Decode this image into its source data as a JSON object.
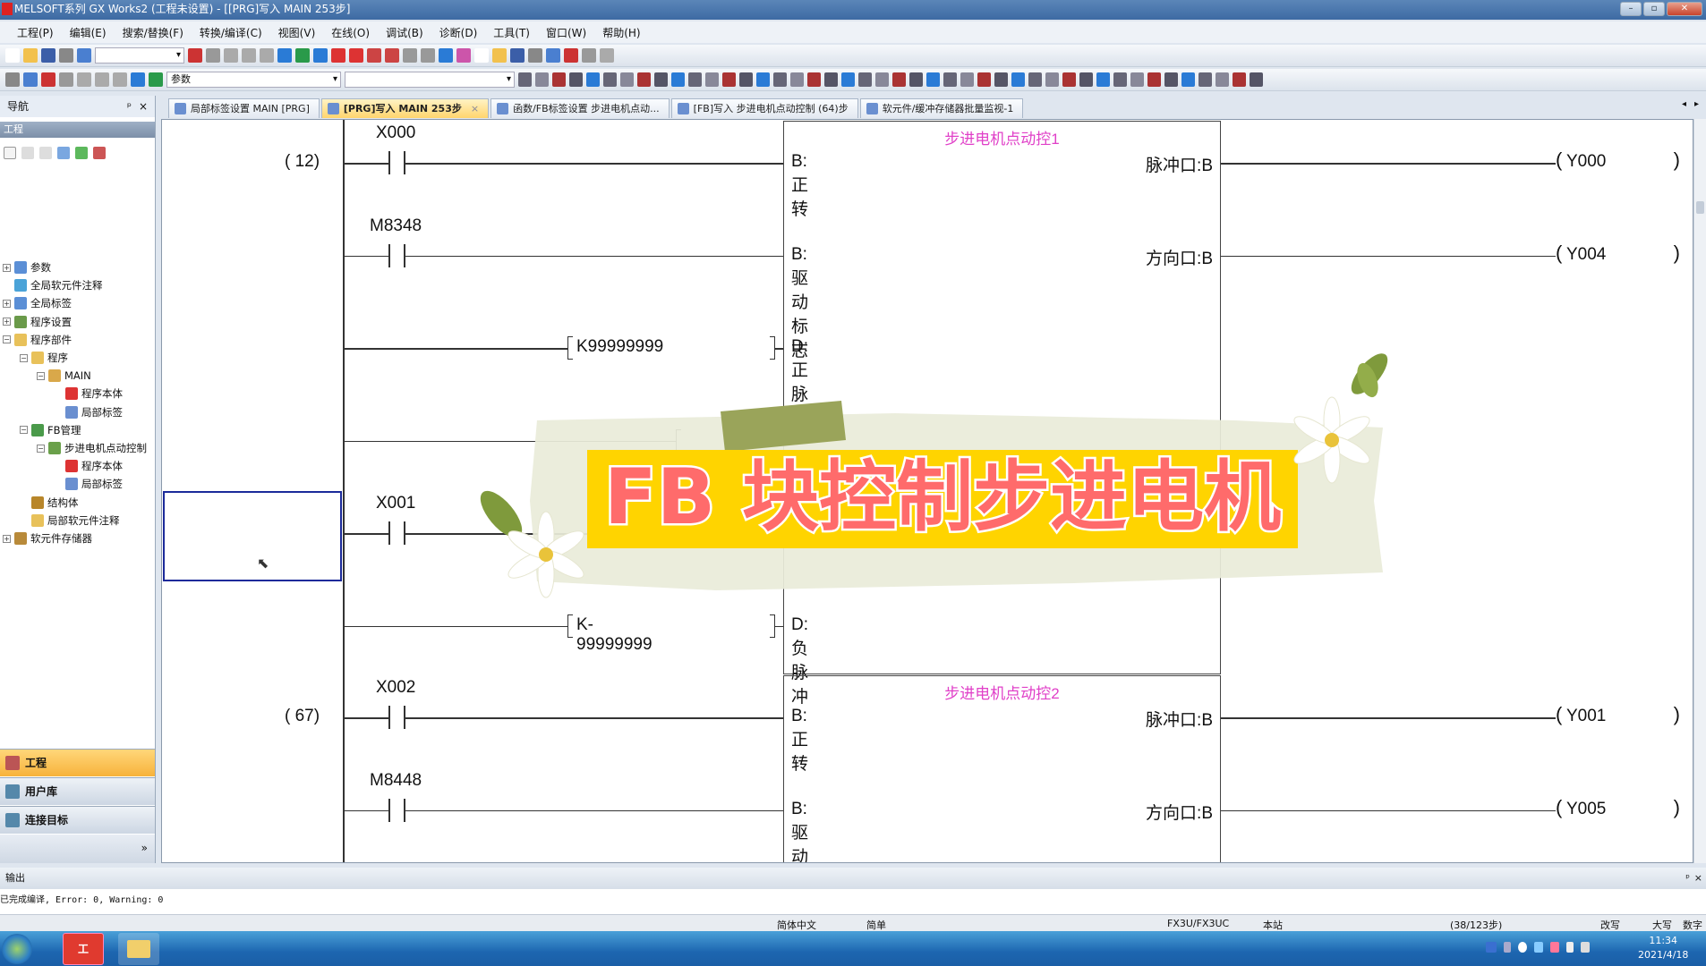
{
  "window": {
    "title": "MELSOFT系列 GX Works2 (工程未设置) - [[PRG]写入 MAIN 253步]"
  },
  "menu": [
    "工程(P)",
    "编辑(E)",
    "搜索/替换(F)",
    "转换/编译(C)",
    "视图(V)",
    "在线(O)",
    "调试(B)",
    "诊断(D)",
    "工具(T)",
    "窗口(W)",
    "帮助(H)"
  ],
  "toolbar": {
    "combo_label": "参数"
  },
  "tabs": [
    {
      "label": "局部标签设置 MAIN [PRG]",
      "active": false
    },
    {
      "label": "[PRG]写入 MAIN 253步",
      "active": true,
      "closable": "×"
    },
    {
      "label": "函数/FB标签设置 步进电机点动...",
      "active": false
    },
    {
      "label": "[FB]写入 步进电机点动控制 (64)步",
      "active": false
    },
    {
      "label": "软元件/缓冲存储器批量监视-1",
      "active": false
    }
  ],
  "navigation": {
    "title": "导航",
    "pin": "ᵖ",
    "close": "×",
    "section": "工程",
    "tree": [
      {
        "label": "参数",
        "level": 0,
        "expander": "+"
      },
      {
        "label": "全局软元件注释",
        "level": 0,
        "expander": ""
      },
      {
        "label": "全局标签",
        "level": 0,
        "expander": "+"
      },
      {
        "label": "程序设置",
        "level": 0,
        "expander": "+"
      },
      {
        "label": "程序部件",
        "level": 0,
        "expander": "−"
      },
      {
        "label": "程序",
        "level": 1,
        "expander": "−"
      },
      {
        "label": "MAIN",
        "level": 2,
        "expander": "−"
      },
      {
        "label": "程序本体",
        "level": 3,
        "expander": ""
      },
      {
        "label": "局部标签",
        "level": 3,
        "expander": ""
      },
      {
        "label": "FB管理",
        "level": 1,
        "expander": "−"
      },
      {
        "label": "步进电机点动控制",
        "level": 2,
        "expander": "−"
      },
      {
        "label": "程序本体",
        "level": 3,
        "expander": ""
      },
      {
        "label": "局部标签",
        "level": 3,
        "expander": ""
      },
      {
        "label": "结构体",
        "level": 1,
        "expander": ""
      },
      {
        "label": "局部软元件注释",
        "level": 1,
        "expander": ""
      },
      {
        "label": "软元件存储器",
        "level": 0,
        "expander": "+"
      }
    ],
    "bottom_buttons": [
      {
        "label": "工程",
        "active": true
      },
      {
        "label": "用户库",
        "active": false
      },
      {
        "label": "连接目标",
        "active": false
      }
    ],
    "more": "»"
  },
  "ladder": {
    "blocks": [
      {
        "step": "( 12)",
        "title": "步进电机点动控1",
        "rows": [
          {
            "contact": "X000",
            "input": "B:正转",
            "output": "脉冲口:B",
            "coil": "Y000"
          },
          {
            "contact": "M8348",
            "input": "B:驱动标志",
            "output": "方向口:B",
            "coil": "Y004"
          },
          {
            "constant": "K99999999",
            "input": "D:正脉冲"
          },
          {
            "constant": "",
            "partial": true
          },
          {
            "contact": "X001",
            "partial": true
          },
          {
            "constant": "K-99999999",
            "input": "D:负脉冲"
          }
        ]
      },
      {
        "step": "( 67)",
        "title": "步进电机点动控2",
        "rows": [
          {
            "contact": "X002",
            "input": "B:正转",
            "output": "脉冲口:B",
            "coil": "Y001"
          },
          {
            "contact": "M8448",
            "input": "B:驱动标志",
            "output": "方向口:B",
            "coil": "Y005"
          }
        ]
      }
    ]
  },
  "overlay": {
    "caption": "FB 块控制步进电机",
    "caption_color": "#ff6b6b",
    "banner_color": "#ffd400"
  },
  "output": {
    "title": "输出",
    "message": "已完成编译, Error: 0, Warning: 0"
  },
  "status": {
    "language": "简体中文",
    "mode": "简单",
    "cpu": "FX3U/FX3UC",
    "station": "本站",
    "steps": "(38/123步)",
    "overwrite": "改写",
    "caps": "大写",
    "num": "数字"
  },
  "taskbar": {
    "time": "11:34",
    "date": "2021/4/18"
  }
}
